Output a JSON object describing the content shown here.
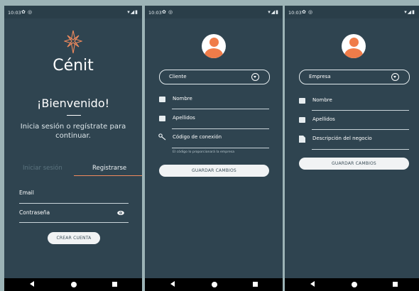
{
  "status": {
    "time": "10:03",
    "gear": "✿",
    "circle": "◎",
    "sys": "▾◢▮"
  },
  "screen1": {
    "brand": "Cénit",
    "welcome": "¡Bienvenido!",
    "subtitle": "Inicia sesión o regístrate para continuar.",
    "tab_login": "Iniciar sesión",
    "tab_register": "Registrarse",
    "email_label": "Email",
    "password_label": "Contraseña",
    "create_button": "CREAR CUENTA"
  },
  "screen2": {
    "select_value": "Cliente",
    "field_name": "Nombre",
    "field_surname": "Apellidos",
    "field_code": "Código de conexión",
    "helper": "El código lo proporcionará la empresa",
    "save_button": "GUARDAR CAMBIOS"
  },
  "screen3": {
    "select_value": "Empresa",
    "field_name": "Nombre",
    "field_surname": "Apellidos",
    "field_business": "Descripción del negocio",
    "save_button": "GUARDAR CAMBIOS"
  },
  "colors": {
    "background": "#9cb3b6",
    "screen": "#2f4450",
    "accent": "#f07c49"
  },
  "icons": [
    "settings-icon",
    "radio-icon",
    "wifi-icon",
    "signal-icon",
    "battery-icon",
    "compass-star-logo",
    "visibility-icon",
    "person-icon",
    "key-icon",
    "business-icon",
    "dropdown-icon",
    "back-icon",
    "home-icon",
    "recents-icon"
  ]
}
